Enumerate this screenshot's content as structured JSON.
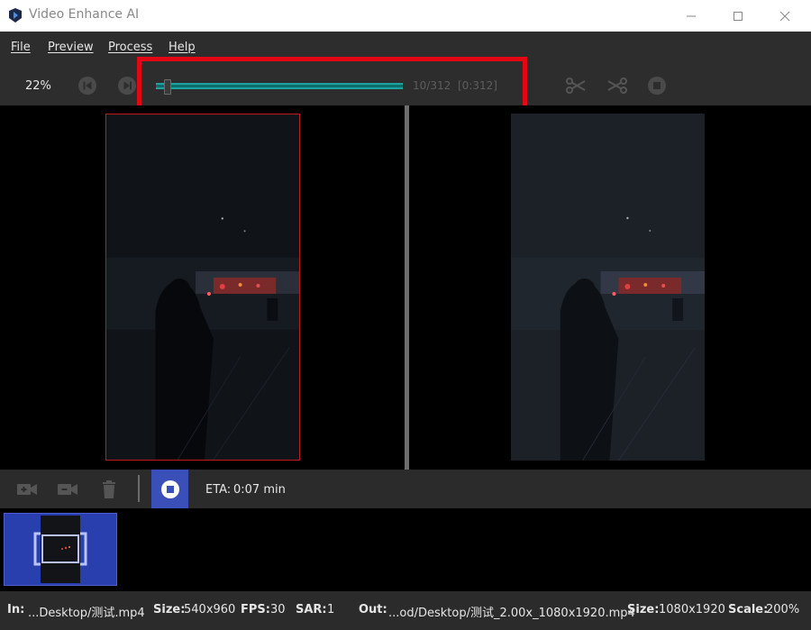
{
  "window": {
    "title": "Video Enhance AI",
    "controls": [
      "minimize",
      "maximize",
      "close"
    ]
  },
  "menu": {
    "items": [
      {
        "label": "File"
      },
      {
        "label": "Preview"
      },
      {
        "label": "Process"
      },
      {
        "label": "Help"
      }
    ]
  },
  "toolbar": {
    "zoom": "22%",
    "progress_fraction": 0.032,
    "frame_counter": "10/312",
    "frame_range": "[0:312]",
    "icons": [
      "skip-to-start-icon",
      "play-icon",
      "cut-start-icon",
      "cut-end-icon",
      "stop-icon"
    ]
  },
  "preview": {
    "left_label": "input-frame",
    "right_label": "output-frame"
  },
  "controls": {
    "eta_label": "ETA:",
    "eta_value": "0:07 min"
  },
  "colors": {
    "accent": "#3b4fb8",
    "progress": "#1aa3a0",
    "highlight": "#e30613"
  },
  "status": {
    "in_label": "In:",
    "in_value": "...Desktop/测试.mp4",
    "size_label": "Size:",
    "size_value": "540x960",
    "fps_label": "FPS:",
    "fps_value": "30",
    "sar_label": "SAR:",
    "sar_value": "1",
    "out_label": "Out:",
    "out_value": "...od/Desktop/测试_2.00x_1080x1920.mp4",
    "out_size_label": "Size:",
    "out_size_value": "1080x1920",
    "scale_label": "Scale:",
    "scale_value": "200%"
  }
}
